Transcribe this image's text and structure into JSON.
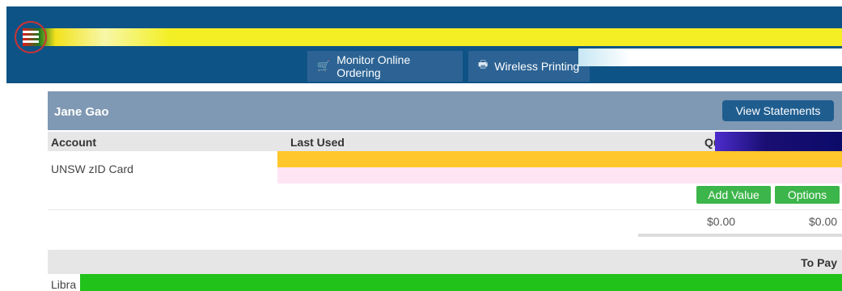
{
  "header": {
    "nav": [
      {
        "icon": "shopping-cart-icon",
        "label": "Monitor Online Ordering"
      },
      {
        "icon": "printer-icon",
        "label": "Wireless Printing"
      }
    ],
    "menu_icon": "hamburger-menu-icon",
    "colors": {
      "bar": "#0e5386",
      "nav_button": "#2c6394"
    }
  },
  "card": {
    "user_name": "Jane Gao",
    "view_statements_label": "View Statements",
    "columns": {
      "account": "Account",
      "last_used": "Last Used",
      "quota": "Qu"
    },
    "accounts": [
      {
        "name": "UNSW zID Card",
        "actions": {
          "add_value": "Add Value",
          "options": "Options"
        },
        "amounts": [
          "$0.00",
          "$0.00"
        ]
      }
    ],
    "to_pay_header": "To Pay",
    "next_account_partial": "Libra",
    "colors": {
      "header": "#7f98b3",
      "action_green": "#3cb54a",
      "button_blue": "#1f5d8f"
    }
  }
}
